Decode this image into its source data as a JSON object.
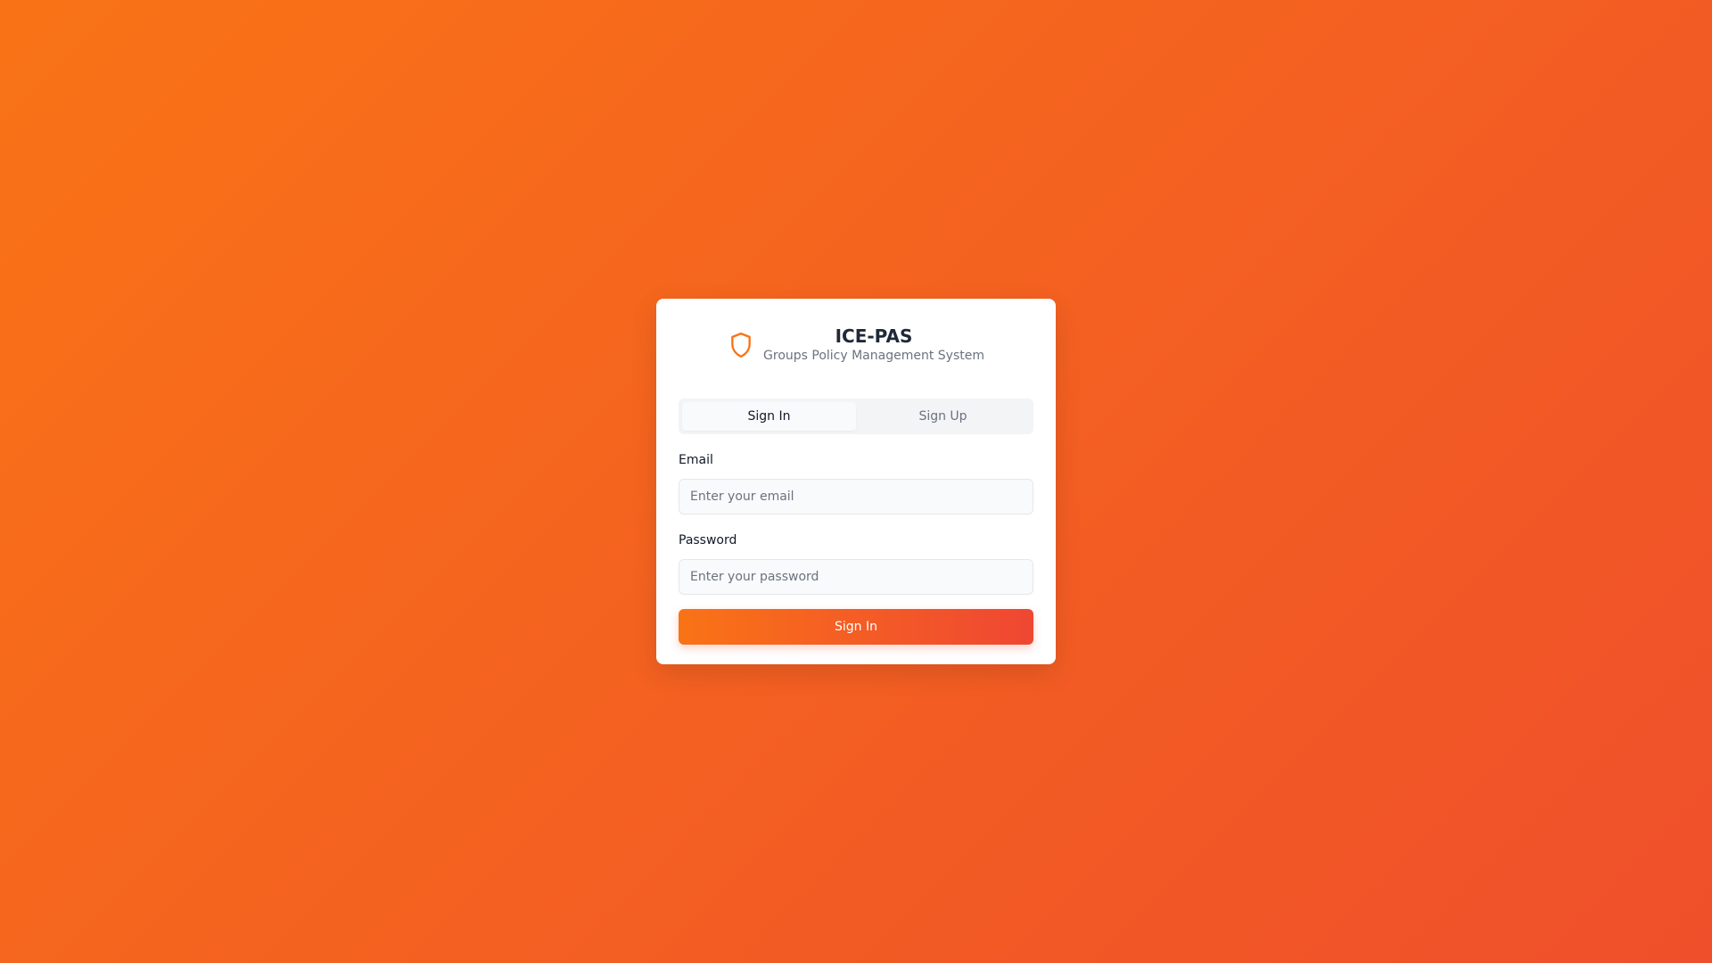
{
  "brand": {
    "title": "ICE-PAS",
    "subtitle": "Groups Policy Management System",
    "icon": "shield-icon",
    "accent_color": "#f97316"
  },
  "tabs": [
    {
      "label": "Sign In",
      "active": true
    },
    {
      "label": "Sign Up",
      "active": false
    }
  ],
  "form": {
    "email": {
      "label": "Email",
      "placeholder": "Enter your email",
      "value": ""
    },
    "password": {
      "label": "Password",
      "placeholder": "Enter your password",
      "value": ""
    },
    "submit_label": "Sign In"
  }
}
